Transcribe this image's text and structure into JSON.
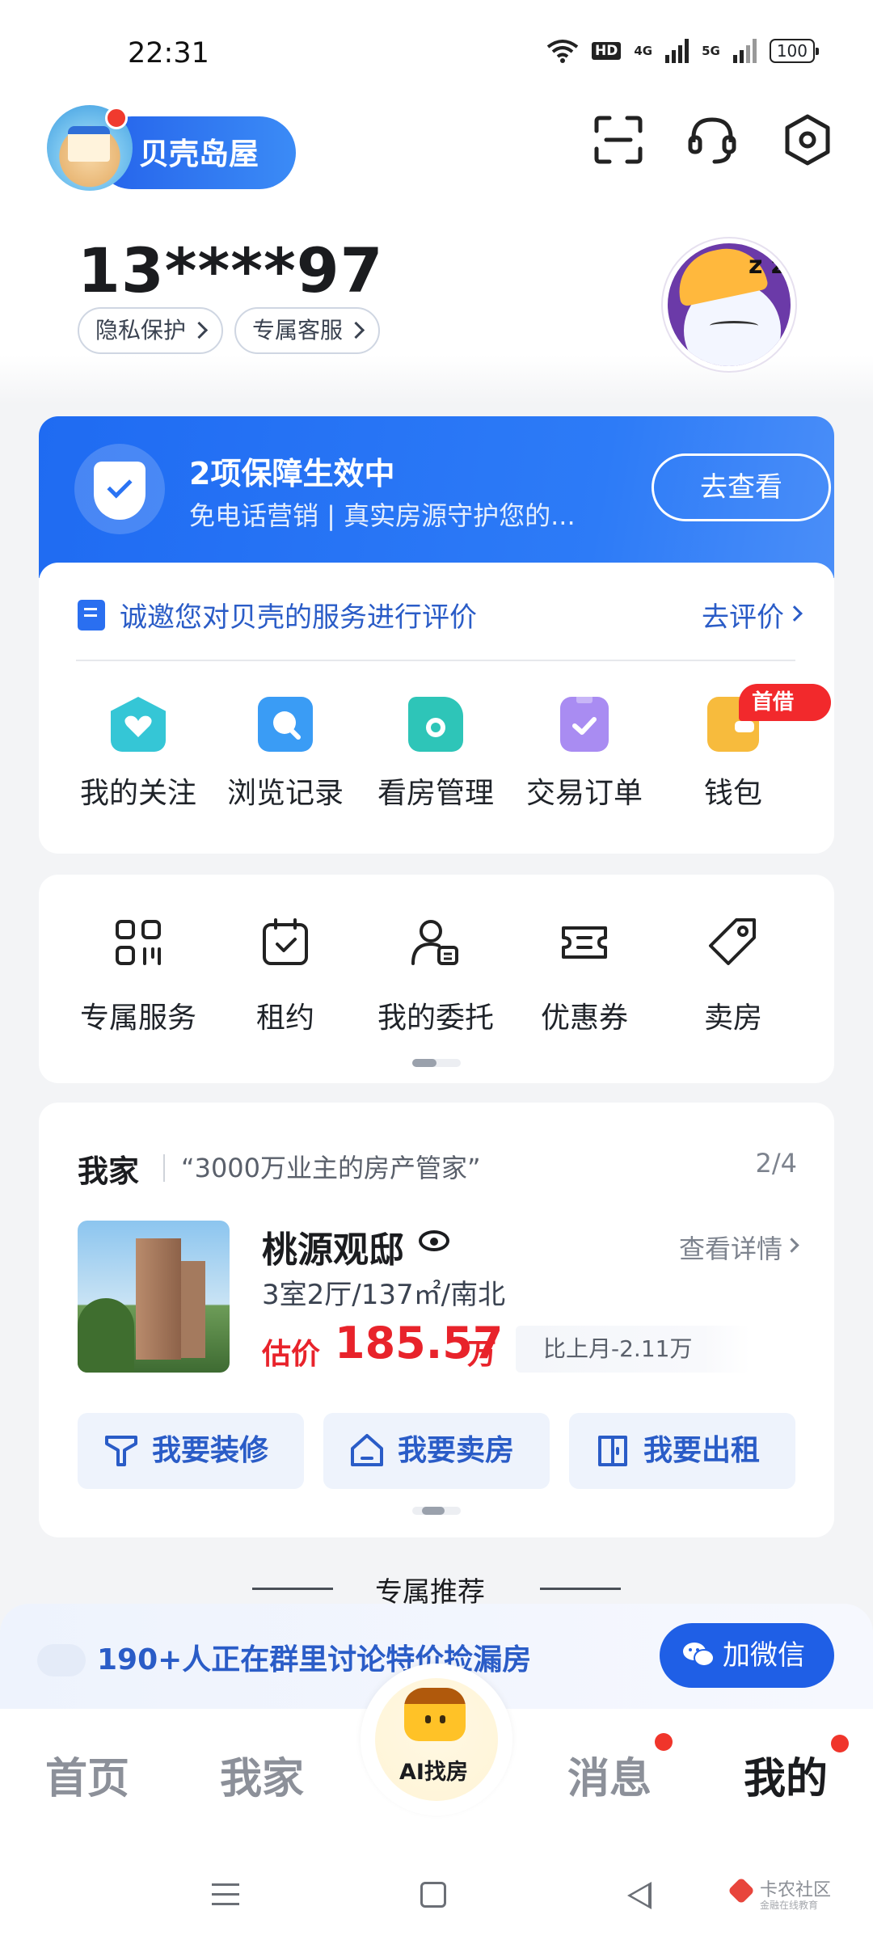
{
  "status_bar": {
    "time": "22:31",
    "hd": "HD",
    "net1": "4G",
    "net2": "5G",
    "battery": "100"
  },
  "header": {
    "logo_text": "贝壳岛屋",
    "icons": [
      "scan-icon",
      "customer-service-icon",
      "settings-icon"
    ]
  },
  "profile": {
    "phone": "13****97",
    "chips": [
      "隐私保护",
      "专属客服"
    ]
  },
  "protection": {
    "title": "2项保障生效中",
    "subtitle": "免电话营销 | 真实房源守护您的...",
    "button": "去查看",
    "color": "#1f6bf2"
  },
  "evaluation": {
    "text": "诚邀您对贝壳的服务进行评价",
    "link": "去评价"
  },
  "services": {
    "items": [
      {
        "label": "我的关注",
        "icon": "heart-house-icon",
        "color": "#35c6d6"
      },
      {
        "label": "浏览记录",
        "icon": "chat-search-icon",
        "color": "#3a9cf5"
      },
      {
        "label": "看房管理",
        "icon": "folder-camera-icon",
        "color": "#2ec5b8"
      },
      {
        "label": "交易订单",
        "icon": "clipboard-check-icon",
        "color": "#a98cf2"
      },
      {
        "label": "钱包",
        "icon": "wallet-icon",
        "color": "#f7bb3d"
      }
    ],
    "badge": "首借"
  },
  "tools": {
    "items": [
      {
        "label": "专属服务",
        "icon": "grid-icon"
      },
      {
        "label": "租约",
        "icon": "calendar-check-icon"
      },
      {
        "label": "我的委托",
        "icon": "user-card-icon"
      },
      {
        "label": "优惠券",
        "icon": "coupon-icon"
      },
      {
        "label": "卖房",
        "icon": "tag-icon"
      }
    ]
  },
  "home": {
    "title": "我家",
    "slogan": "“3000万业主的房产管家”",
    "page": "2/4",
    "name": "桃源观邸",
    "detail_link": "查看详情",
    "spec": "3室2厅/137㎡/南北",
    "estimate_label": "估价",
    "estimate_value": "185.57",
    "estimate_unit": "万",
    "compare": "比上月-2.11万",
    "actions": [
      "我要装修",
      "我要卖房",
      "我要出租"
    ]
  },
  "recommend": {
    "title": "专属推荐"
  },
  "banner": {
    "text": "190+人正在群里讨论特价捡漏房",
    "button": "加微信"
  },
  "tabbar": {
    "tabs": [
      "首页",
      "我家",
      "AI找房",
      "消息",
      "我的"
    ],
    "active": "我的"
  },
  "watermark": {
    "text": "卡农社区",
    "sub": "金融在线教育"
  }
}
